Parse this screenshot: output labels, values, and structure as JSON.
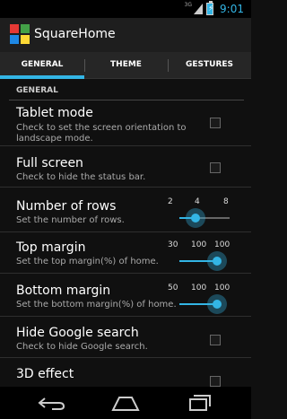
{
  "status_bar": {
    "network": "3G",
    "time": "9:01"
  },
  "app": {
    "title": "SquareHome"
  },
  "tabs": [
    {
      "label": "GENERAL",
      "selected": true
    },
    {
      "label": "THEME",
      "selected": false
    },
    {
      "label": "GESTURES",
      "selected": false
    }
  ],
  "section": {
    "title": "GENERAL"
  },
  "prefs": {
    "tablet_mode": {
      "title": "Tablet mode",
      "summary": "Check to set the screen orientation to landscape mode.",
      "checked": false
    },
    "full_screen": {
      "title": "Full screen",
      "summary": "Check to hide the status bar.",
      "checked": false
    },
    "rows": {
      "title": "Number of rows",
      "summary": "Set the number of rows.",
      "min": "2",
      "value": "4",
      "max": "8",
      "level": 0.33
    },
    "top_margin": {
      "title": "Top margin",
      "summary": "Set the top margin(%) of home.",
      "min": "30",
      "value": "100",
      "max": "100",
      "level": 1.0
    },
    "bottom_margin": {
      "title": "Bottom margin",
      "summary": "Set the bottom margin(%) of home.",
      "min": "50",
      "value": "100",
      "max": "100",
      "level": 1.0
    },
    "hide_google": {
      "title": "Hide Google search",
      "summary": "Check to hide Google search.",
      "checked": false
    },
    "effect_3d": {
      "title": "3D effect",
      "checked": false
    }
  },
  "colors": {
    "accent": "#33b5e5",
    "background": "#101010"
  },
  "nav_icons": [
    "back-icon",
    "home-icon",
    "recents-icon"
  ]
}
